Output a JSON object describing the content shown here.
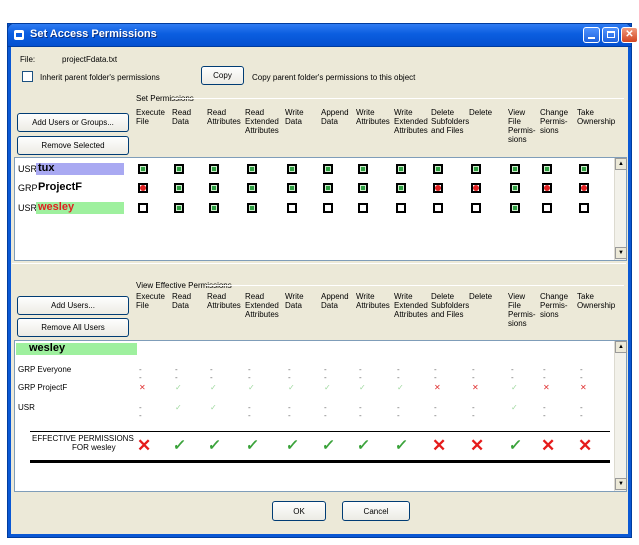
{
  "window": {
    "title": "Set Access Permissions"
  },
  "file": {
    "label": "File:",
    "name": "projectFdata.txt"
  },
  "inherit": {
    "label": "Inherit parent folder's permissions"
  },
  "copy": {
    "button": "Copy",
    "description": "Copy parent folder's permissions to this object"
  },
  "set_permissions": {
    "title": "Set Permissions",
    "add_button": "Add Users or Groups...",
    "remove_button": "Remove Selected",
    "rows": [
      {
        "type": "USR",
        "name": "tux",
        "highlight": "#a9a9f2",
        "name_color": "#000000",
        "values": [
          "g",
          "g",
          "g",
          "g",
          "g",
          "g",
          "g",
          "g",
          "g",
          "g",
          "g",
          "g",
          "g"
        ]
      },
      {
        "type": "GRP",
        "name": "ProjectF",
        "highlight": "",
        "name_color": "#000000",
        "values": [
          "r",
          "g",
          "g",
          "g",
          "g",
          "g",
          "g",
          "g",
          "r",
          "r",
          "g",
          "r",
          "r"
        ]
      },
      {
        "type": "USR",
        "name": "wesley",
        "highlight": "#9ef09e",
        "name_color": "#e02020",
        "values": [
          "e",
          "g",
          "g",
          "g",
          "e",
          "e",
          "e",
          "e",
          "e",
          "e",
          "g",
          "e",
          "e"
        ]
      }
    ]
  },
  "columns": [
    "Execute File",
    "Read Data",
    "Read Attributes",
    "Read Extended Attributes",
    "Write Data",
    "Append Data",
    "Write Attributes",
    "Write Extended Attributes",
    "Delete Subfolders and Files",
    "Delete",
    "View File Permis- sions",
    "Change Permis- sions",
    "Take Ownership"
  ],
  "effective": {
    "title": "View Effective Permissions",
    "add_button": "Add Users...",
    "remove_button": "Remove All Users",
    "user": "wesley",
    "user_highlight": "#9ef09e",
    "rows": [
      {
        "label": "GRP Everyone",
        "values": [
          "-",
          "-",
          "-",
          "-",
          "-",
          "-",
          "-",
          "-",
          "-",
          "-",
          "-",
          "-",
          "-"
        ]
      },
      {
        "label": "GRP ProjectF",
        "values": [
          "x",
          "v",
          "v",
          "v",
          "v",
          "v",
          "v",
          "v",
          "x",
          "x",
          "v",
          "x",
          "x"
        ]
      },
      {
        "label": "USR",
        "values": [
          "-",
          "v",
          "v",
          "-",
          "-",
          "-",
          "-",
          "-",
          "-",
          "-",
          "v",
          "-",
          "-"
        ]
      }
    ],
    "summary_label_1": "EFFECTIVE PERMISSIONS",
    "summary_label_2": "FOR wesley",
    "summary": [
      "x",
      "v",
      "v",
      "v",
      "v",
      "v",
      "v",
      "v",
      "x",
      "x",
      "v",
      "x",
      "x"
    ]
  },
  "footer": {
    "ok": "OK",
    "cancel": "Cancel"
  }
}
